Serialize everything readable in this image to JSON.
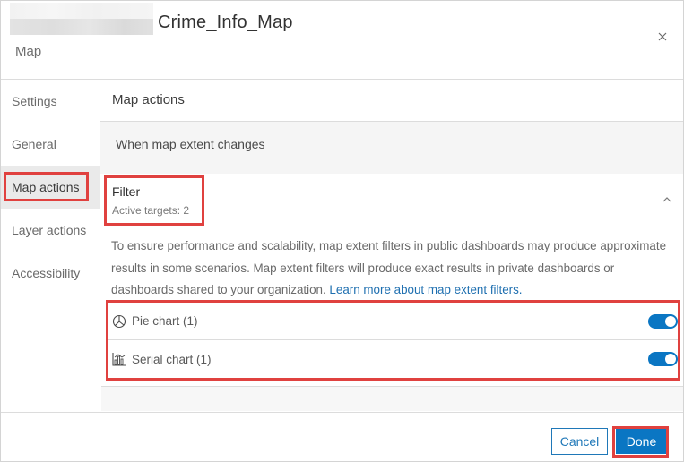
{
  "header": {
    "title": "Crime_Info_Map",
    "subtitle": "Map",
    "close_icon": "close-icon"
  },
  "sidebar": {
    "items": [
      {
        "label": "Settings",
        "active": false
      },
      {
        "label": "General",
        "active": false
      },
      {
        "label": "Map actions",
        "active": true
      },
      {
        "label": "Layer actions",
        "active": false
      },
      {
        "label": "Accessibility",
        "active": false
      }
    ]
  },
  "main": {
    "section_title": "Map actions",
    "trigger_label": "When map extent changes",
    "filter": {
      "title": "Filter",
      "subtitle": "Active targets: 2",
      "expanded": true,
      "chevron_icon": "chevron-up-icon"
    },
    "info_text": "To ensure performance and scalability, map extent filters in public dashboards may produce approximate results in some scenarios. Map extent filters will produce exact results in private dashboards or dashboards shared to your organization. ",
    "info_link": "Learn more about map extent filters.",
    "targets": [
      {
        "label": "Pie chart (1)",
        "icon": "pie-chart-icon",
        "enabled": true
      },
      {
        "label": "Serial chart (1)",
        "icon": "serial-chart-icon",
        "enabled": true
      }
    ]
  },
  "footer": {
    "cancel_label": "Cancel",
    "done_label": "Done"
  },
  "colors": {
    "accent": "#0a76c3",
    "highlight": "#e0413f",
    "link": "#1e6fb0"
  }
}
